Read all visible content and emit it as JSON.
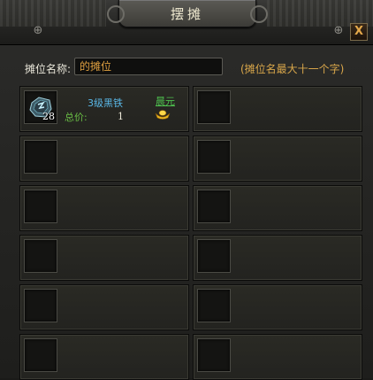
{
  "window": {
    "title": "摆摊",
    "close_label": "X"
  },
  "stall_name": {
    "label": "摊位名称:",
    "value": "的摊位",
    "hint": "(摊位名最大十一个字)"
  },
  "slots": [
    {
      "item_name": "3级黑铁",
      "count": "28",
      "total_label": "总价:",
      "total_value": "1",
      "currency_label": "晨元",
      "currency_icon": "gold-ingot-icon",
      "item_icon": "black-iron-ore-icon"
    },
    {},
    {},
    {},
    {},
    {},
    {},
    {},
    {},
    {},
    {},
    {}
  ],
  "colors": {
    "item_name": "#5ab8e8",
    "total_label": "#6abf45",
    "currency_link": "#4ec04e",
    "hint": "#d8a64a",
    "input_text": "#e0a040"
  }
}
